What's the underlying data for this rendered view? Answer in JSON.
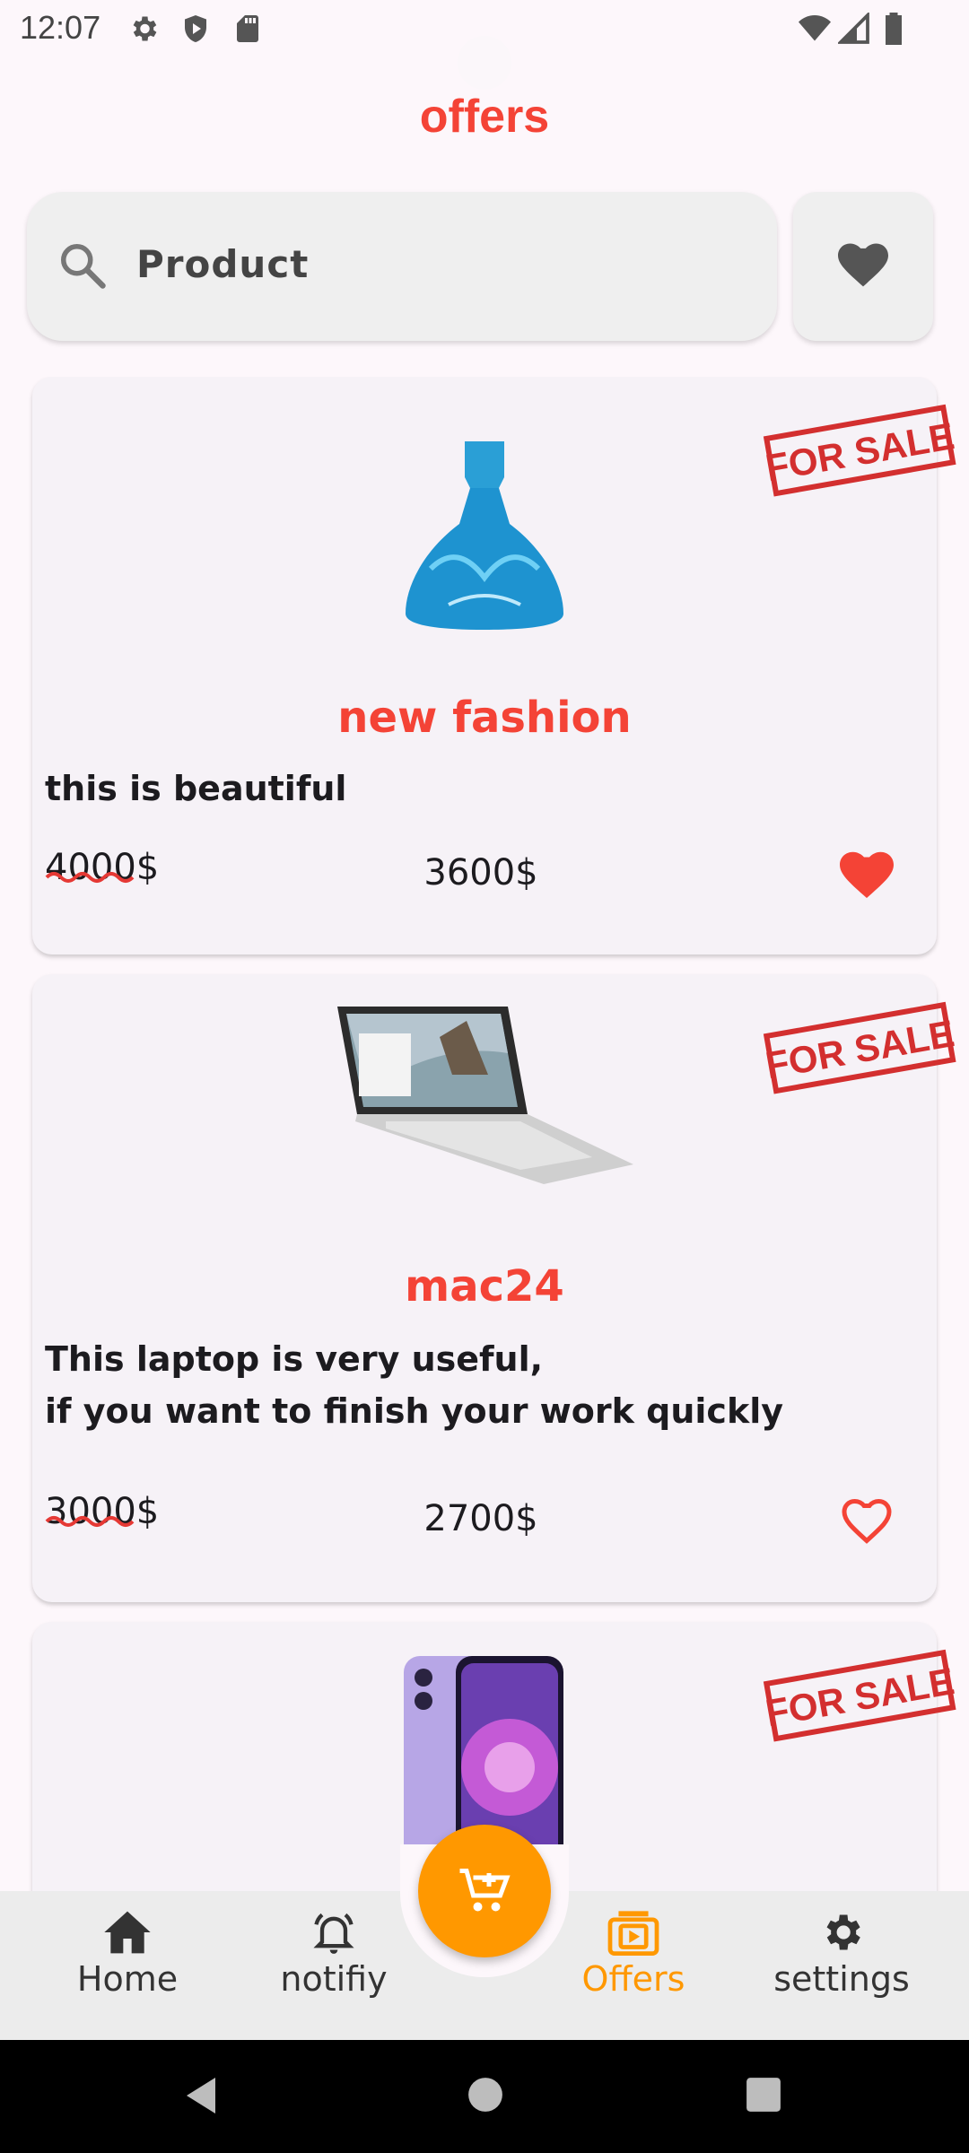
{
  "status_bar": {
    "time": "12:07",
    "icons": [
      "gear-icon",
      "shield-play-icon",
      "sd-card-icon",
      "wifi-icon",
      "signal-icon",
      "battery-icon"
    ]
  },
  "header": {
    "title": "offers"
  },
  "search": {
    "placeholder": "Product"
  },
  "colors": {
    "accent": "#f44336",
    "orange": "#ff9800",
    "card": "#f6f2f7"
  },
  "products": [
    {
      "image": "blue-ball-gown",
      "badge": "FOR SALE",
      "name": "new fashion",
      "description": "this is beautiful",
      "old_price": "4000$",
      "new_price": "3600$",
      "favorited": true
    },
    {
      "image": "laptop",
      "badge": "FOR SALE",
      "name": "mac24",
      "description": "This laptop is very useful,\nif you want to finish your work quickly",
      "old_price": "3000$",
      "new_price": "2700$",
      "favorited": false
    },
    {
      "image": "purple-smartphone",
      "badge": "FOR SALE"
    }
  ],
  "bottom_nav": {
    "items": [
      {
        "label": "Home",
        "icon": "home-icon"
      },
      {
        "label": "notifiy",
        "icon": "bell-icon"
      },
      {
        "label": "Offers",
        "icon": "offers-icon",
        "active": true
      },
      {
        "label": "settings",
        "icon": "gear-icon"
      }
    ],
    "fab_icon": "cart-add-icon"
  }
}
